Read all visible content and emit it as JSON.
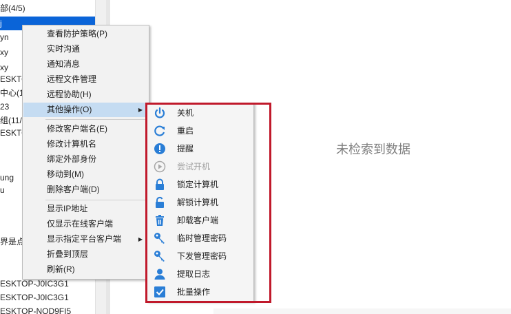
{
  "tree": {
    "rows": [
      "部(4/5)",
      "",
      "yn",
      "xy",
      "xy",
      "ESKTO",
      "中心(1/",
      "23",
      "组(11/",
      "ESKTO",
      "",
      "",
      "ung",
      "u",
      "",
      "",
      "",
      "界是点",
      "",
      "",
      "ESKTOP-J0IC3G1",
      "ESKTOP-J0IC3G1",
      "ESKTOP-NOD9FI5"
    ],
    "selected_label": "j"
  },
  "main": {
    "empty_text": "未检索到数据",
    "bottom_text": "..."
  },
  "context_menu": {
    "items": [
      "查看防护策略(P)",
      "实时沟通",
      "通知消息",
      "远程文件管理",
      "远程协助(H)",
      "其他操作(O)",
      "修改客户端名(E)",
      "修改计算机名",
      "绑定外部身份",
      "移动到(M)",
      "删除客户端(D)",
      "显示IP地址",
      "仅显示在线客户端",
      "显示指定平台客户端",
      "折叠到顶层",
      "刷新(R)"
    ],
    "submenu_arrow": "▶"
  },
  "submenu": {
    "items": [
      {
        "label": "关机",
        "icon": "power-icon"
      },
      {
        "label": "重启",
        "icon": "restart-icon"
      },
      {
        "label": "提醒",
        "icon": "alert-icon"
      },
      {
        "label": "尝试开机",
        "icon": "play-icon"
      },
      {
        "label": "锁定计算机",
        "icon": "lock-icon"
      },
      {
        "label": "解锁计算机",
        "icon": "unlock-icon"
      },
      {
        "label": "卸载客户端",
        "icon": "trash-icon"
      },
      {
        "label": "临时管理密码",
        "icon": "key-icon"
      },
      {
        "label": "下发管理密码",
        "icon": "key-icon"
      },
      {
        "label": "提取日志",
        "icon": "user-icon"
      },
      {
        "label": "批量操作",
        "icon": "checkbox-icon"
      }
    ],
    "accent_color": "#2a7ed6",
    "disabled_color": "#a0a0a0",
    "highlight_frame_color": "#c0192b"
  }
}
